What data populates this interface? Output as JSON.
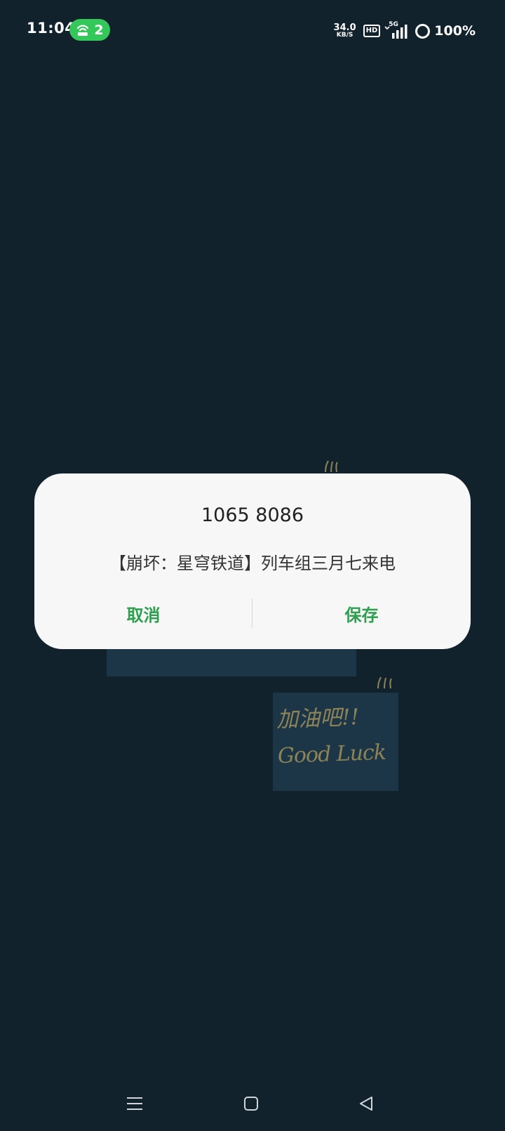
{
  "status_bar": {
    "time": "11:04",
    "hotspot_icon": "hotspot-icon",
    "hotspot_count": "2",
    "net_speed_value": "34.0",
    "net_speed_unit": "KB/S",
    "hd_label": "HD",
    "network_type": "5G",
    "signal_icon": "signal-bars-icon",
    "battery_icon": "battery-ring-icon",
    "battery_percent": "100%"
  },
  "wallpaper": {
    "note_text_line1": "加油吧!!",
    "note_text_line2": "Good Luck"
  },
  "dialog": {
    "title": "1065 8086",
    "message": "【崩坏：星穹铁道】列车组三月七来电",
    "cancel_label": "取消",
    "save_label": "保存"
  },
  "nav_bar": {
    "menu_icon": "menu-icon",
    "home_icon": "home-icon",
    "back_icon": "back-icon"
  },
  "colors": {
    "background": "#12222c",
    "accent_green": "#2e9e4f",
    "hotspot_green": "#34c759",
    "dialog_bg": "#f7f7f7",
    "note_bg": "#1c3648"
  }
}
